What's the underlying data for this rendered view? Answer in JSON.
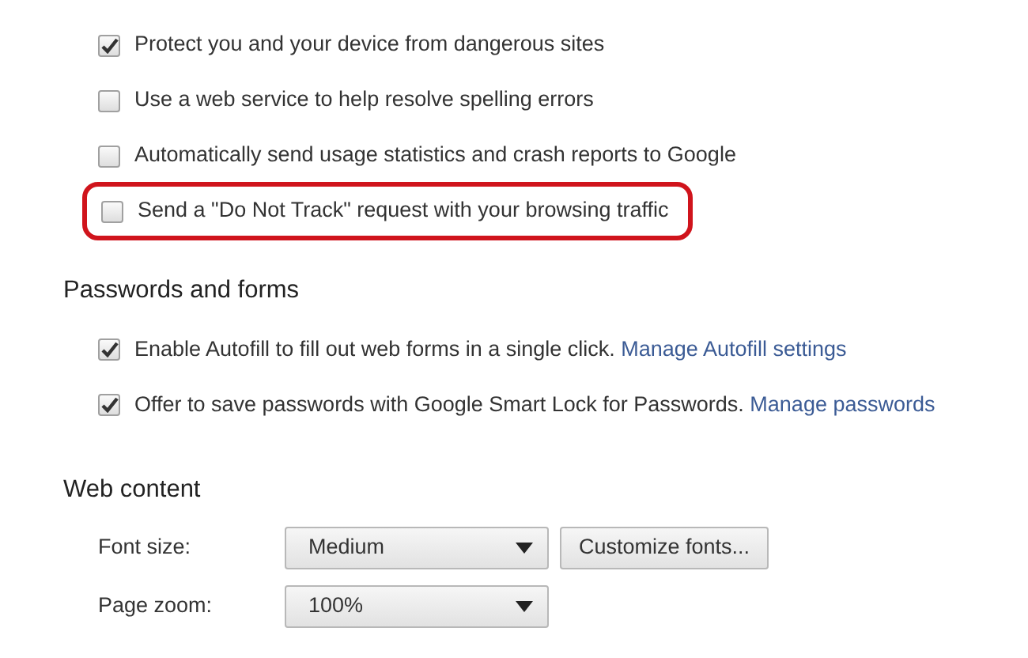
{
  "privacy_options": [
    {
      "label": "Protect you and your device from dangerous sites",
      "checked": true,
      "highlighted": false
    },
    {
      "label": "Use a web service to help resolve spelling errors",
      "checked": false,
      "highlighted": false
    },
    {
      "label": "Automatically send usage statistics and crash reports to Google",
      "checked": false,
      "highlighted": false
    },
    {
      "label": "Send a \"Do Not Track\" request with your browsing traffic",
      "checked": false,
      "highlighted": true
    }
  ],
  "passwords_and_forms": {
    "heading": "Passwords and forms",
    "options": [
      {
        "label": "Enable Autofill to fill out web forms in a single click.",
        "link": "Manage Autofill settings",
        "checked": true
      },
      {
        "label": "Offer to save passwords with Google Smart Lock for Passwords.",
        "link": "Manage passwords",
        "checked": true
      }
    ]
  },
  "web_content": {
    "heading": "Web content",
    "settings": [
      {
        "label": "Font size:",
        "value": "Medium",
        "button": "Customize fonts..."
      },
      {
        "label": "Page zoom:",
        "value": "100%"
      }
    ]
  }
}
